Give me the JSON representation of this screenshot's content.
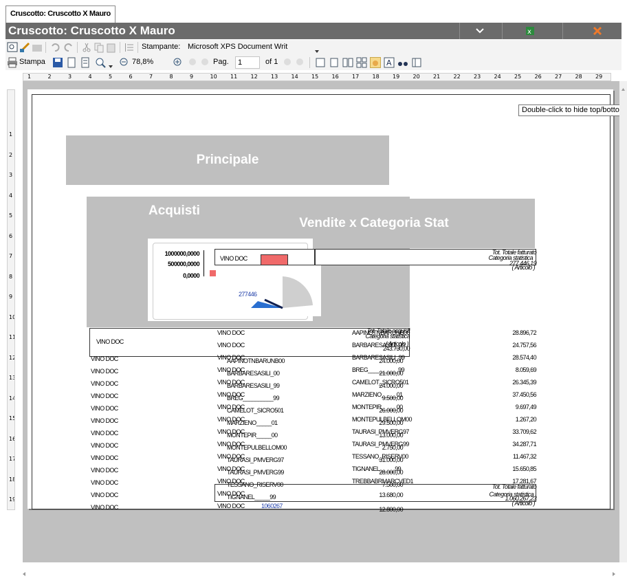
{
  "tab": {
    "label": "Cruscotto: Cruscotto X Mauro"
  },
  "title": "Cruscotto: Cruscotto X Mauro",
  "toolbar": {
    "printer_label": "Stampante:",
    "printer_value": "Microsoft XPS Document Writ",
    "print_label": "Stampa",
    "zoom": "78,8%",
    "page_label": "Pag.",
    "page_value": "1",
    "page_of": "of 1"
  },
  "ruler": {
    "h": [
      "1",
      "2",
      "3",
      "4",
      "5",
      "6",
      "7",
      "8",
      "9",
      "10",
      "11",
      "12",
      "13",
      "14",
      "15",
      "16",
      "17",
      "18",
      "19",
      "20",
      "21",
      "22",
      "23",
      "24",
      "25",
      "26",
      "27",
      "28",
      "29"
    ],
    "v": [
      "1",
      "2",
      "3",
      "4",
      "5",
      "6",
      "7",
      "8",
      "9",
      "10",
      "11",
      "12",
      "13",
      "14",
      "15",
      "16",
      "17",
      "18",
      "19",
      "20"
    ]
  },
  "tooltip": "Double-click to hide top/botto",
  "report": {
    "principale": "Principale",
    "acquisti": "Acquisti",
    "vendite": "Vendite x Categoria Stat",
    "chart": {
      "y1": "1000000,0000",
      "y2": "500000,0000",
      "y3": "0,0000",
      "gauge_value": "277446"
    },
    "tot_label_1": "Tot. Totale fatturato",
    "tot_label_2": "Categoria statistica",
    "tot_label_3": "( Articolo )",
    "tot_value": "277.446,19",
    "vino_doc": "VINO DOC",
    "tot_acq_1": "Tot. Totale acquisti",
    "tot_acq_2": "Categoria statistica",
    "tot_acq_3": "( Articolo )",
    "tot_acq_value": "243.730,00",
    "col_a": [
      "VINO DOC",
      "VINO DOC",
      "VINO DOC",
      "VINO DOC",
      "VINO DOC",
      "VINO DOC",
      "VINO DOC",
      "VINO DOC",
      "VINO DOC",
      "VINO DOC",
      "VINO DOC",
      "VINO DOC",
      "VINO DOC"
    ],
    "col_b_vino": [
      "VINO DOC",
      "VINO DOC",
      "VINO DOC",
      "VINO DOC",
      "VINO DOC",
      "VINO DOC",
      "VINO DOC",
      "VINO DOC",
      "VINO DOC",
      "VINO DOC",
      "VINO DOC",
      "VINO DOC",
      "VINO DOC",
      "VINO DOC",
      "VINO DOC"
    ],
    "col_b_art": [
      "AAPINOTNBARUNB00",
      "BARBARESASILI_00",
      "BARBARESASILI_99",
      "BREG__________99",
      "CAMELOT_SICRO501",
      "MARZIENO_____01",
      "MONTEPIR_____00",
      "MONTEPULBELLOM00",
      "TAURASI_PMVERG97",
      "TAURASI_PMVERG99",
      "TESSANO_RISERV00",
      "TIGNANEL_____99"
    ],
    "col_c_art": [
      "AAPINOTNBARUNB00",
      "BARBARESASILI_00",
      "BARBARESASILI_99",
      "BREG__________99",
      "CAMELOT_SICRO501",
      "MARZIENO_____01",
      "MONTEPIR_____00",
      "MONTEPULBELLOM00",
      "TAURASI_PMVERG97",
      "TAURASI_PMVERG99",
      "TESSANO_RISERV00",
      "TIGNANEL_____99",
      "TREBBABRMARCVED1"
    ],
    "col_c_val": [
      "24.000,00",
      "21.000,00",
      "24.000,00",
      "9.500,00",
      "26.000,00",
      "29.500,00",
      "13.000,00",
      "2.750,00",
      "31.000,00",
      "28.000,00",
      "7.500,00",
      "13.680,00",
      "12.800,00"
    ],
    "col_d": [
      "28.896,72",
      "24.757,56",
      "28.574,40",
      "8.059,69",
      "26.345,39",
      "37.450,56",
      "9.697,49",
      "1.267,20",
      "33.709,62",
      "34.287,71",
      "11.467,32",
      "15.650,85",
      "17.281,67"
    ],
    "bottom_total": "1060267",
    "bottom_total2": "1.060.267,23"
  }
}
